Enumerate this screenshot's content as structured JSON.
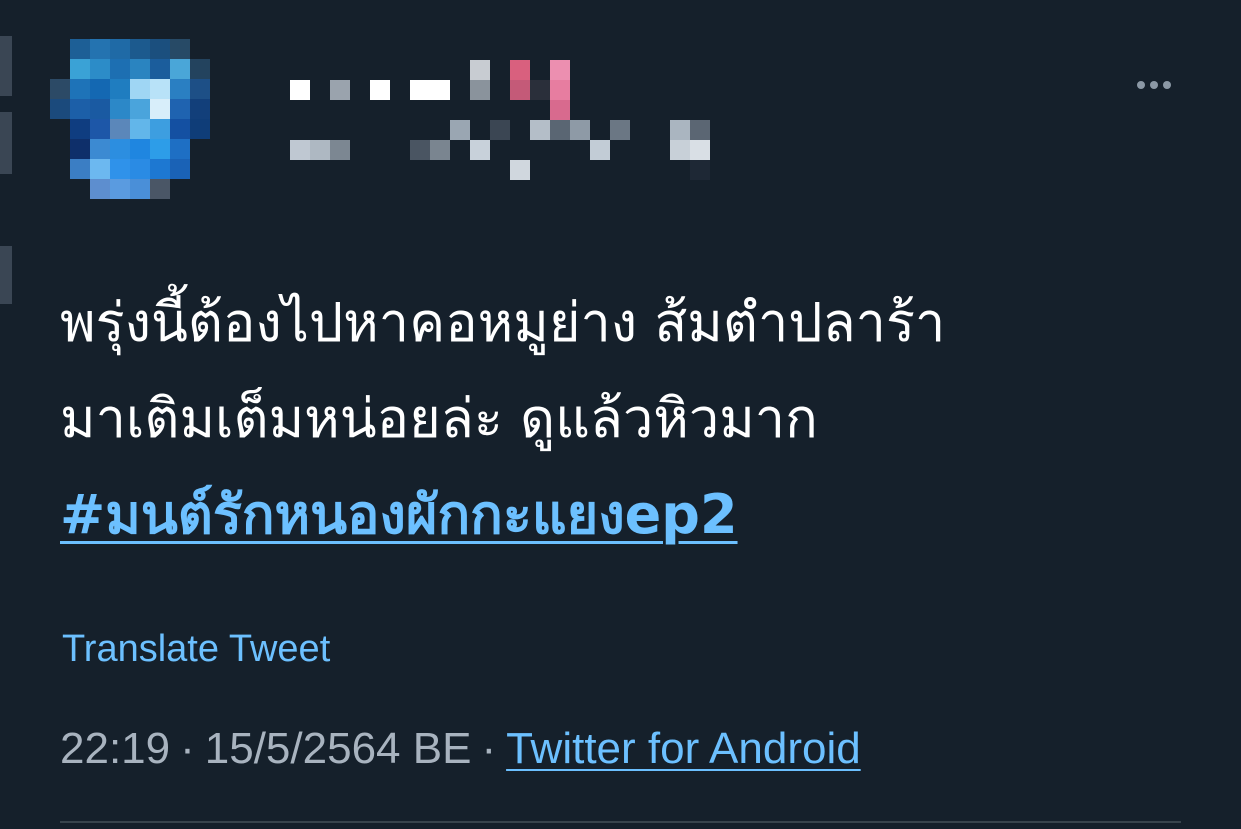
{
  "tweet": {
    "text_lines": [
      "พรุ่งนี้ต้องไปหาคอหมูย่าง ส้มตำปลาร้า",
      "มาเติมเต็มหน่อยล่ะ ดูแล้วหิวมาก"
    ],
    "hashtag": "#มนต์รักหนองผักกะแยงep2",
    "translate_label": "Translate Tweet",
    "time": "22:19",
    "date": "15/5/2564 BE",
    "separator": "·",
    "source": "Twitter for Android"
  },
  "icons": {
    "more": "more-horizontal-icon",
    "avatar": "pixelated-avatar"
  },
  "colors": {
    "background": "#15202b",
    "text": "#ffffff",
    "link": "#6cc0ff",
    "muted": "#a8b3bf"
  }
}
